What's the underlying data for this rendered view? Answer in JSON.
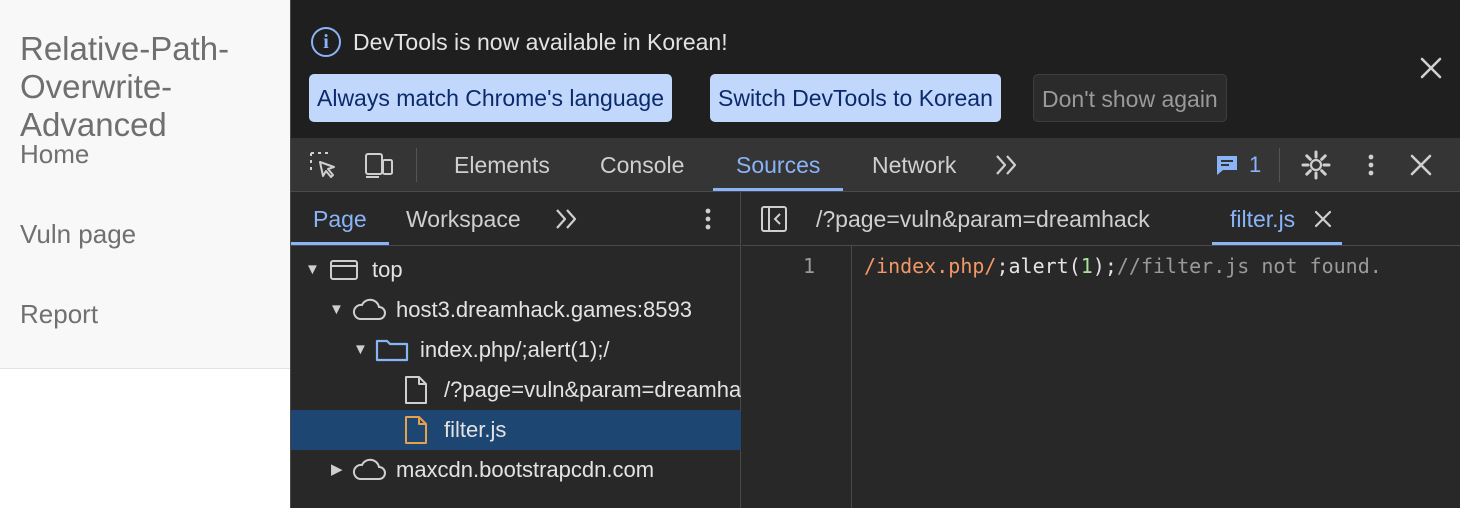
{
  "page": {
    "title": "Relative-Path-Overwrite-Advanced",
    "nav": [
      "Home",
      "Vuln page",
      "Report"
    ]
  },
  "devtools": {
    "banner": {
      "message": "DevTools is now available in Korean!",
      "buttons": {
        "match": "Always match Chrome's language",
        "switch": "Switch DevTools to Korean",
        "dismiss": "Don't show again"
      }
    },
    "tabs": {
      "elements": "Elements",
      "console": "Console",
      "sources": "Sources",
      "network": "Network",
      "active": "Sources"
    },
    "issues_count": "1",
    "navigator": {
      "tabs": {
        "page": "Page",
        "workspace": "Workspace"
      },
      "tree": {
        "top": "top",
        "host": "host3.dreamhack.games:8593",
        "folder": "index.php/;alert(1);/",
        "file1": "/?page=vuln&param=dreamhack",
        "file2": "filter.js",
        "cdn": "maxcdn.bootstrapcdn.com"
      }
    },
    "editor": {
      "tabs": {
        "first": "/?page=vuln&param=dreamhack",
        "second": "filter.js"
      },
      "line_number": "1",
      "code": {
        "t1": "/index.php/",
        "t2": ";alert(",
        "t3": "1",
        "t4": ");",
        "t5": "//filter.js not found."
      }
    }
  },
  "colors": {
    "accent": "#8ab4f8",
    "selection": "#1e4672",
    "folder": "#8ab4f8",
    "file_highlight": "#e8a04a"
  }
}
